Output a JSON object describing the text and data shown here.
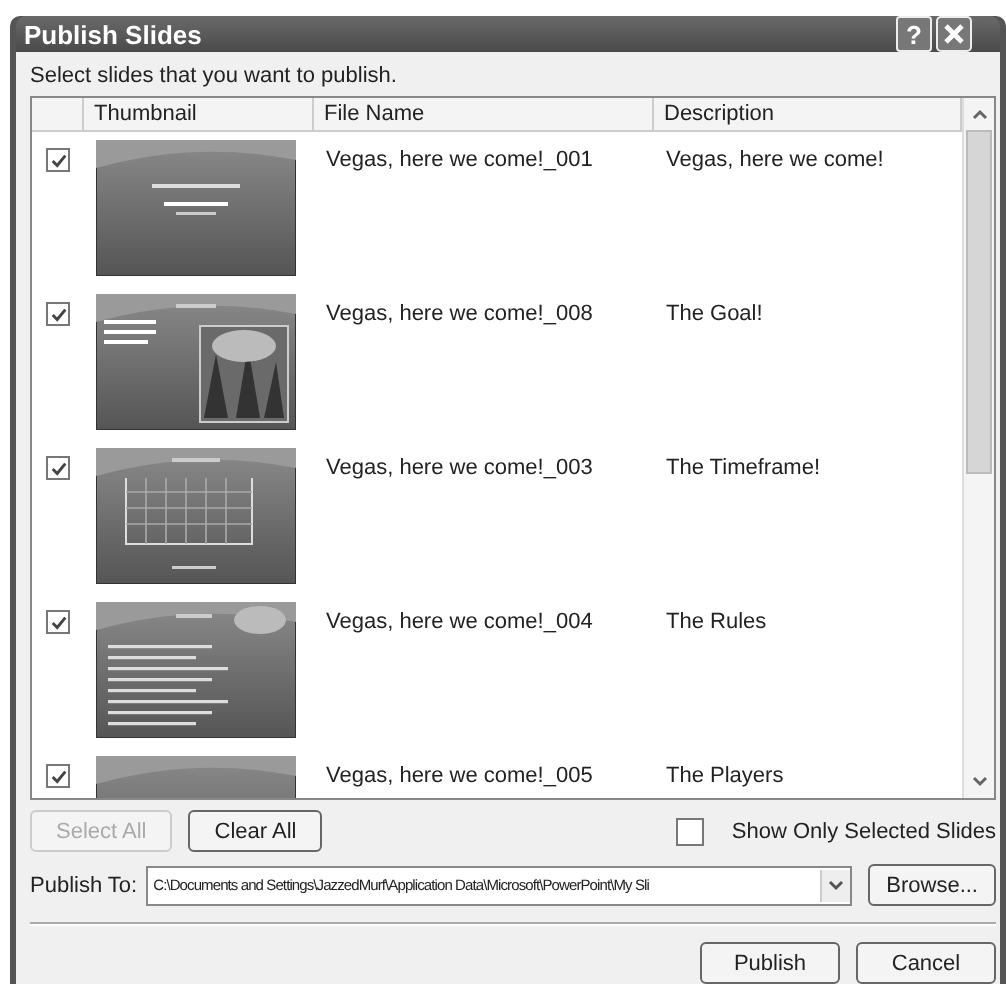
{
  "window": {
    "title": "Publish Slides",
    "help": "?"
  },
  "instruction": "Select slides that you want to publish.",
  "table": {
    "columns": [
      "Thumbnail",
      "File Name",
      "Description"
    ],
    "rows": [
      {
        "checked": true,
        "kind": "title",
        "file_name": "Vegas, here we come!_001",
        "description": "Vegas, here we come!"
      },
      {
        "checked": true,
        "kind": "photo",
        "file_name": "Vegas, here we come!_008",
        "description": "The Goal!"
      },
      {
        "checked": true,
        "kind": "chart",
        "file_name": "Vegas, here we come!_003",
        "description": "The Timeframe!"
      },
      {
        "checked": true,
        "kind": "bullets",
        "file_name": "Vegas, here we come!_004",
        "description": "The Rules"
      },
      {
        "checked": true,
        "kind": "plain",
        "file_name": "Vegas, here we come!_005",
        "description": "The Players"
      }
    ]
  },
  "select_all": {
    "label": "Select All",
    "disabled": true
  },
  "clear_all": {
    "label": "Clear All",
    "disabled": false
  },
  "show_only": {
    "label": "Show Only Selected Slides",
    "checked": false
  },
  "publish_to": {
    "label": "Publish To:",
    "value": "C:\\Documents and Settings\\JazzedMurf\\Application Data\\Microsoft\\PowerPoint\\My Sli"
  },
  "browse": "Browse...",
  "buttons": [
    "Publish",
    "Cancel"
  ]
}
